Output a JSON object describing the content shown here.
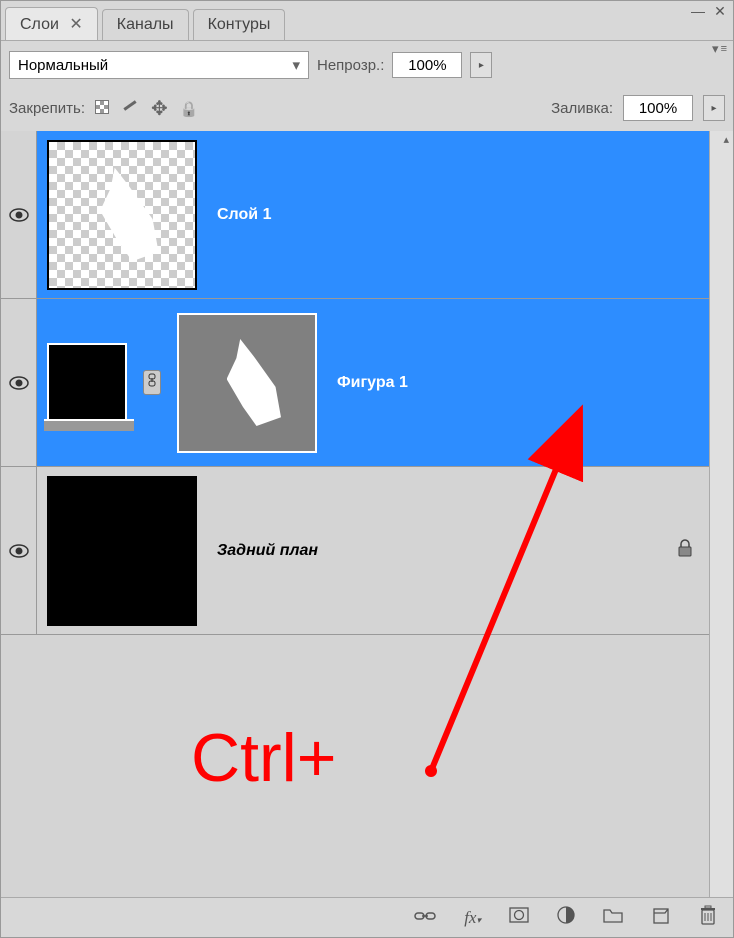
{
  "window": {
    "minimize": "—",
    "close": "✕"
  },
  "tabs": {
    "layers": "Слои",
    "channels": "Каналы",
    "paths": "Контуры"
  },
  "blend_mode": {
    "value": "Нормальный"
  },
  "opacity": {
    "label": "Непрозр.:",
    "value": "100%"
  },
  "lock": {
    "label": "Закрепить:"
  },
  "fill": {
    "label": "Заливка:",
    "value": "100%"
  },
  "layers": [
    {
      "name": "Слой 1"
    },
    {
      "name": "Фигура 1"
    },
    {
      "name": "Задний план"
    }
  ],
  "annotation": "Ctrl+",
  "footer_icons": {
    "link": "link-icon",
    "fx": "fx",
    "mask": "mask-icon",
    "adjust": "adjust-icon",
    "group": "group-icon",
    "new": "new-layer-icon",
    "delete": "trash-icon"
  }
}
